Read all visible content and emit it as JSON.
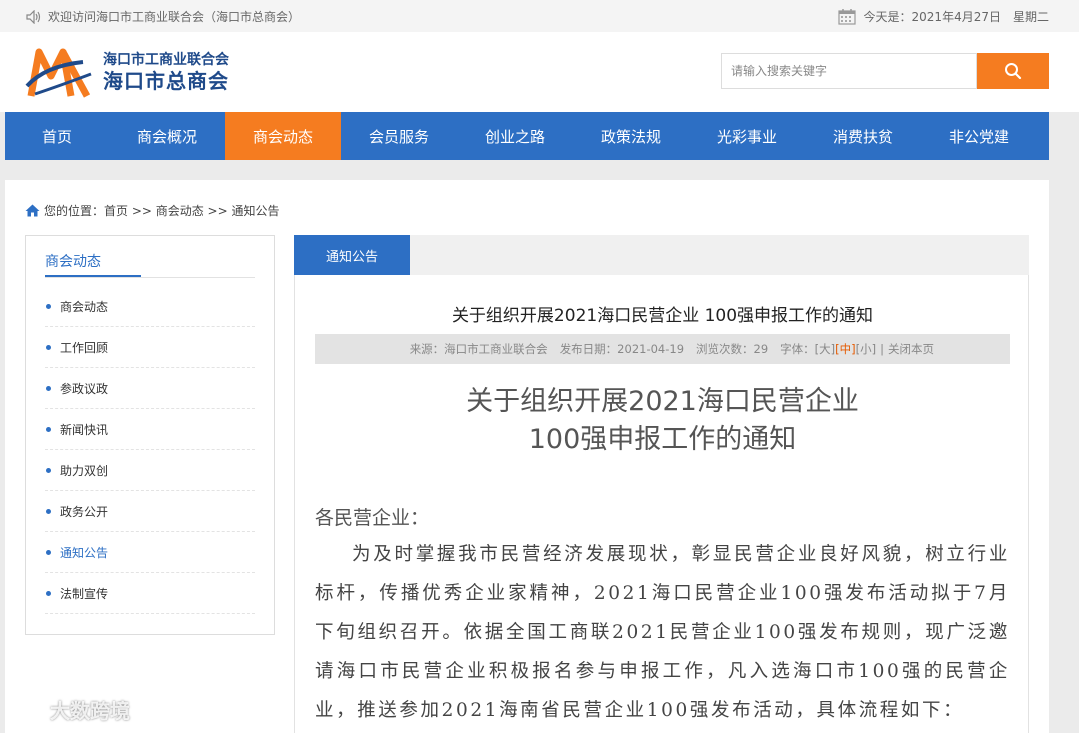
{
  "topbar": {
    "welcome": "欢迎访问海口市工商业联合会（海口市总商会）",
    "date_label": "今天是：2021年4月27日",
    "weekday": "星期二"
  },
  "header": {
    "logo_line1": "海口市工商业联合会",
    "logo_line2": "海口市总商会",
    "search_placeholder": "请输入搜索关键字"
  },
  "nav": {
    "items": [
      "首页",
      "商会概况",
      "商会动态",
      "会员服务",
      "创业之路",
      "政策法规",
      "光彩事业",
      "消费扶贫",
      "非公党建"
    ],
    "active_index": 2
  },
  "breadcrumb": {
    "text": "您的位置：首页 >> 商会动态 >> 通知公告"
  },
  "sidebar": {
    "title": "商会动态",
    "items": [
      "商会动态",
      "工作回顾",
      "参政议政",
      "新闻快讯",
      "助力双创",
      "政务公开",
      "通知公告",
      "法制宣传"
    ],
    "active_index": 6
  },
  "content": {
    "tab_label": "通知公告",
    "article_title": "关于组织开展2021海口民营企业 100强申报工作的通知",
    "meta": {
      "source": "来源：海口市工商业联合会",
      "publish_date": "发布日期：2021-04-19",
      "views": "浏览次数：29",
      "font_label": "字体：",
      "font_large": "[大]",
      "font_medium": "[中]",
      "font_small": "[小]",
      "separator": "|",
      "close": "关闭本页"
    },
    "big_title_line1": "关于组织开展2021海口民营企业",
    "big_title_line2": "100强申报工作的通知",
    "salutation": "各民营企业：",
    "paragraph": "为及时掌握我市民营经济发展现状，彰显民营企业良好风貌，树立行业标杆，传播优秀企业家精神，2021海口民营企业100强发布活动拟于7月下旬组织召开。依据全国工商联2021民营企业100强发布规则，现广泛邀请海口市民营企业积极报名参与申报工作，凡入选海口市100强的民营企业，推送参加2021海南省民营企业100强发布活动，具体流程如下："
  },
  "watermark": "大数跨境",
  "colors": {
    "brand_blue": "#2d6fc4",
    "accent_orange": "#f57c20"
  }
}
